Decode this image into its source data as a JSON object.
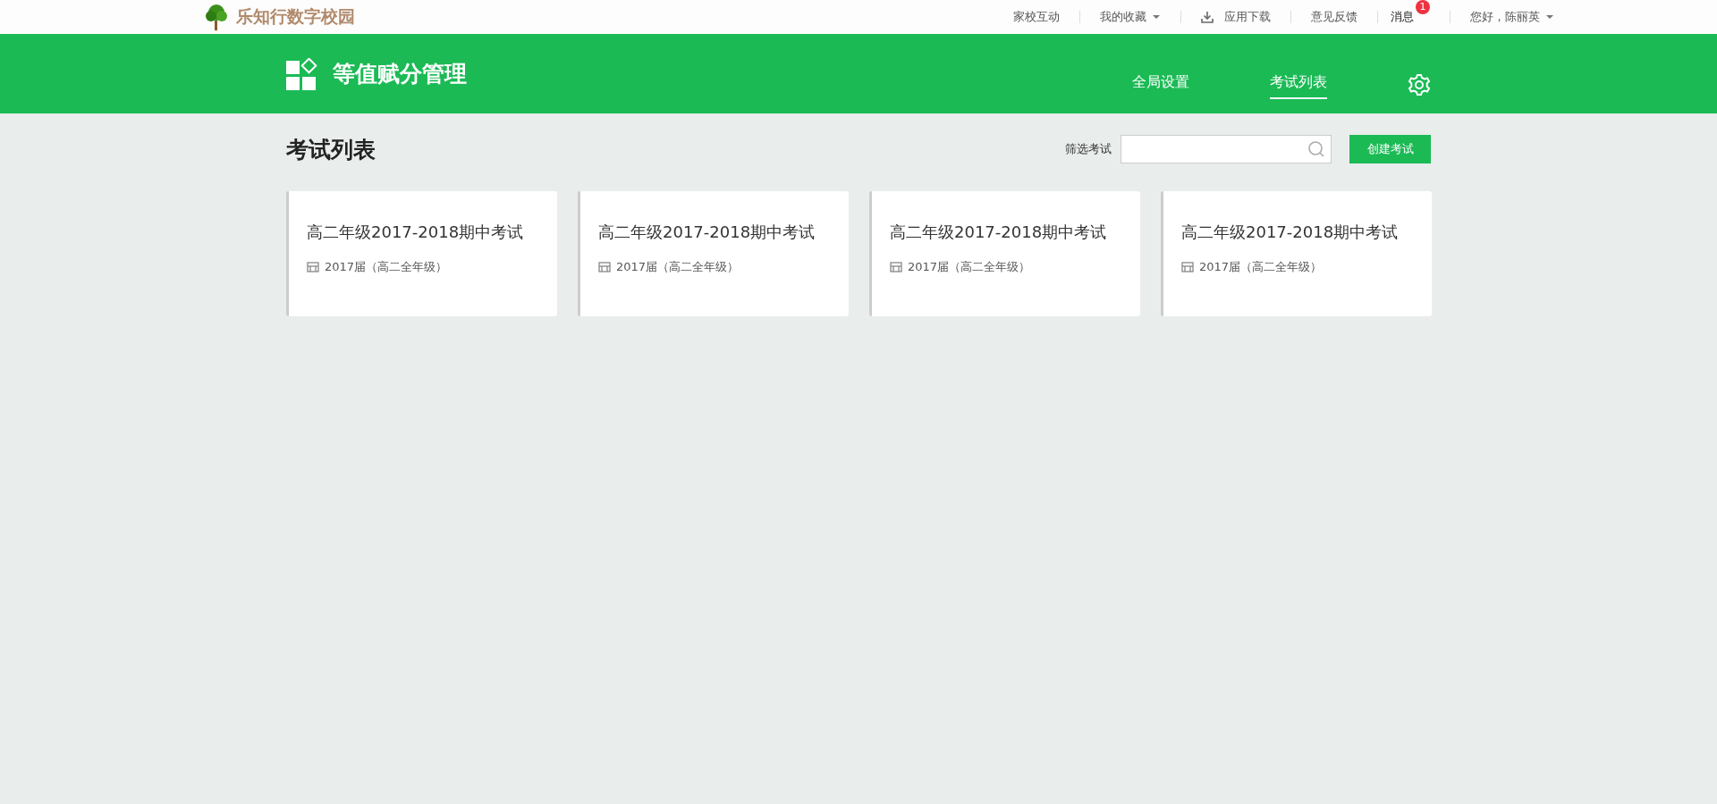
{
  "topbar": {
    "site_name": "乐知行数字校园",
    "links": [
      {
        "kind": "plain",
        "label": "家校互动"
      },
      {
        "kind": "dropdown",
        "label": "我的收藏"
      },
      {
        "kind": "download",
        "label": "应用下载"
      },
      {
        "kind": "plain",
        "label": "意见反馈"
      },
      {
        "kind": "badge",
        "label": "消息",
        "badge": "1"
      },
      {
        "kind": "dropdown",
        "label": "您好，陈丽英"
      }
    ]
  },
  "header": {
    "title": "等值赋分管理",
    "nav": [
      {
        "label": "全局设置",
        "selected": false
      },
      {
        "label": "考试列表",
        "selected": true
      }
    ]
  },
  "page": {
    "title": "考试列表",
    "filter_label": "筛选考试",
    "create_button": "创建考试"
  },
  "exams": [
    {
      "title": "高二年级2017-2018期中考试",
      "cohort": "2017届（高二全年级）"
    },
    {
      "title": "高二年级2017-2018期中考试",
      "cohort": "2017届（高二全年级）"
    },
    {
      "title": "高二年级2017-2018期中考试",
      "cohort": "2017届（高二全年级）"
    },
    {
      "title": "高二年级2017-2018期中考试",
      "cohort": "2017届（高二全年级）"
    }
  ]
}
